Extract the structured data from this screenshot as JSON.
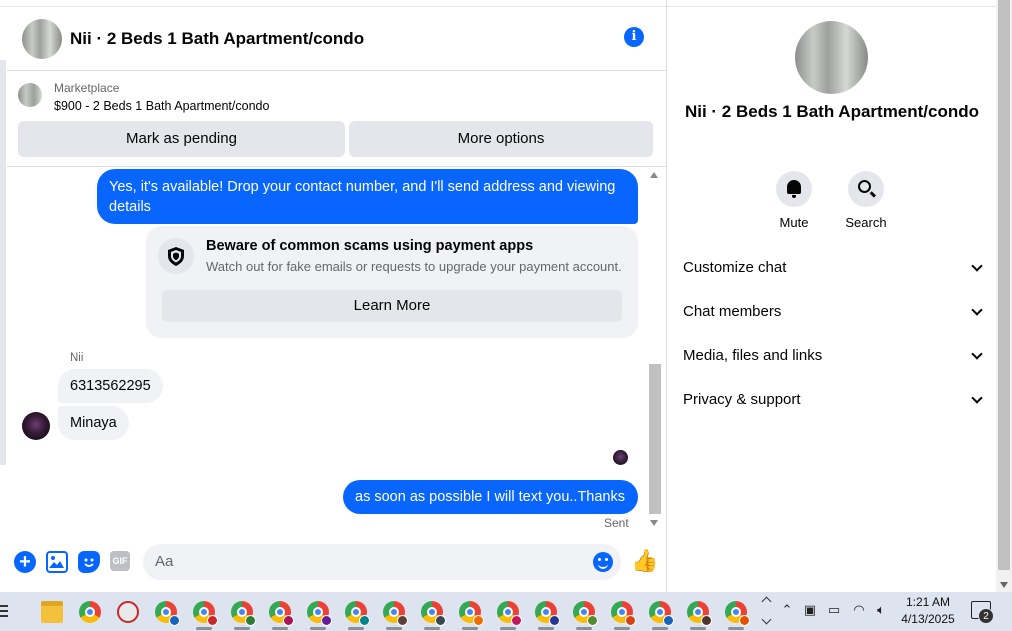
{
  "header": {
    "title": "Nii · 2 Beds 1 Bath Apartment/condo",
    "info_icon": "i"
  },
  "marketplace": {
    "label": "Marketplace",
    "listing": "$900 - 2 Beds 1 Bath Apartment/condo",
    "buttons": [
      "Mark as pending",
      "More options"
    ]
  },
  "messages": {
    "outgoing_1": "Yes, it's available! Drop your contact number, and I'll send address and viewing details",
    "scam_notice": {
      "title": "Beware of common scams using payment apps",
      "subtitle": "Watch out for fake emails or requests to upgrade your payment account.",
      "button": "Learn More"
    },
    "sender_name": "Nii",
    "incoming_1": "6313562295",
    "incoming_2": "Minaya",
    "outgoing_2": "as soon as possible I will text you..Thanks",
    "status": "Sent"
  },
  "composer": {
    "placeholder": "Aa",
    "gif_label": "GIF",
    "plus_label": "+",
    "like_glyph": "👍"
  },
  "info_panel": {
    "name": "Nii · 2 Beds 1 Bath Apartment/condo",
    "actions": [
      "Mute",
      "Search"
    ],
    "sections": [
      "Customize chat",
      "Chat members",
      "Media, files and links",
      "Privacy & support"
    ]
  },
  "taskbar": {
    "time": "1:21 AM",
    "date": "4/13/2025",
    "notification_count": "2",
    "icons": [
      "start-icon",
      "file-explorer-icon",
      "chrome-icon",
      "pinned-app-icon",
      "chrome-profile-icons"
    ]
  },
  "colors": {
    "accent": "#0866ff",
    "bubble_in": "#f0f2f5",
    "taskbar": "#dde4ef"
  }
}
